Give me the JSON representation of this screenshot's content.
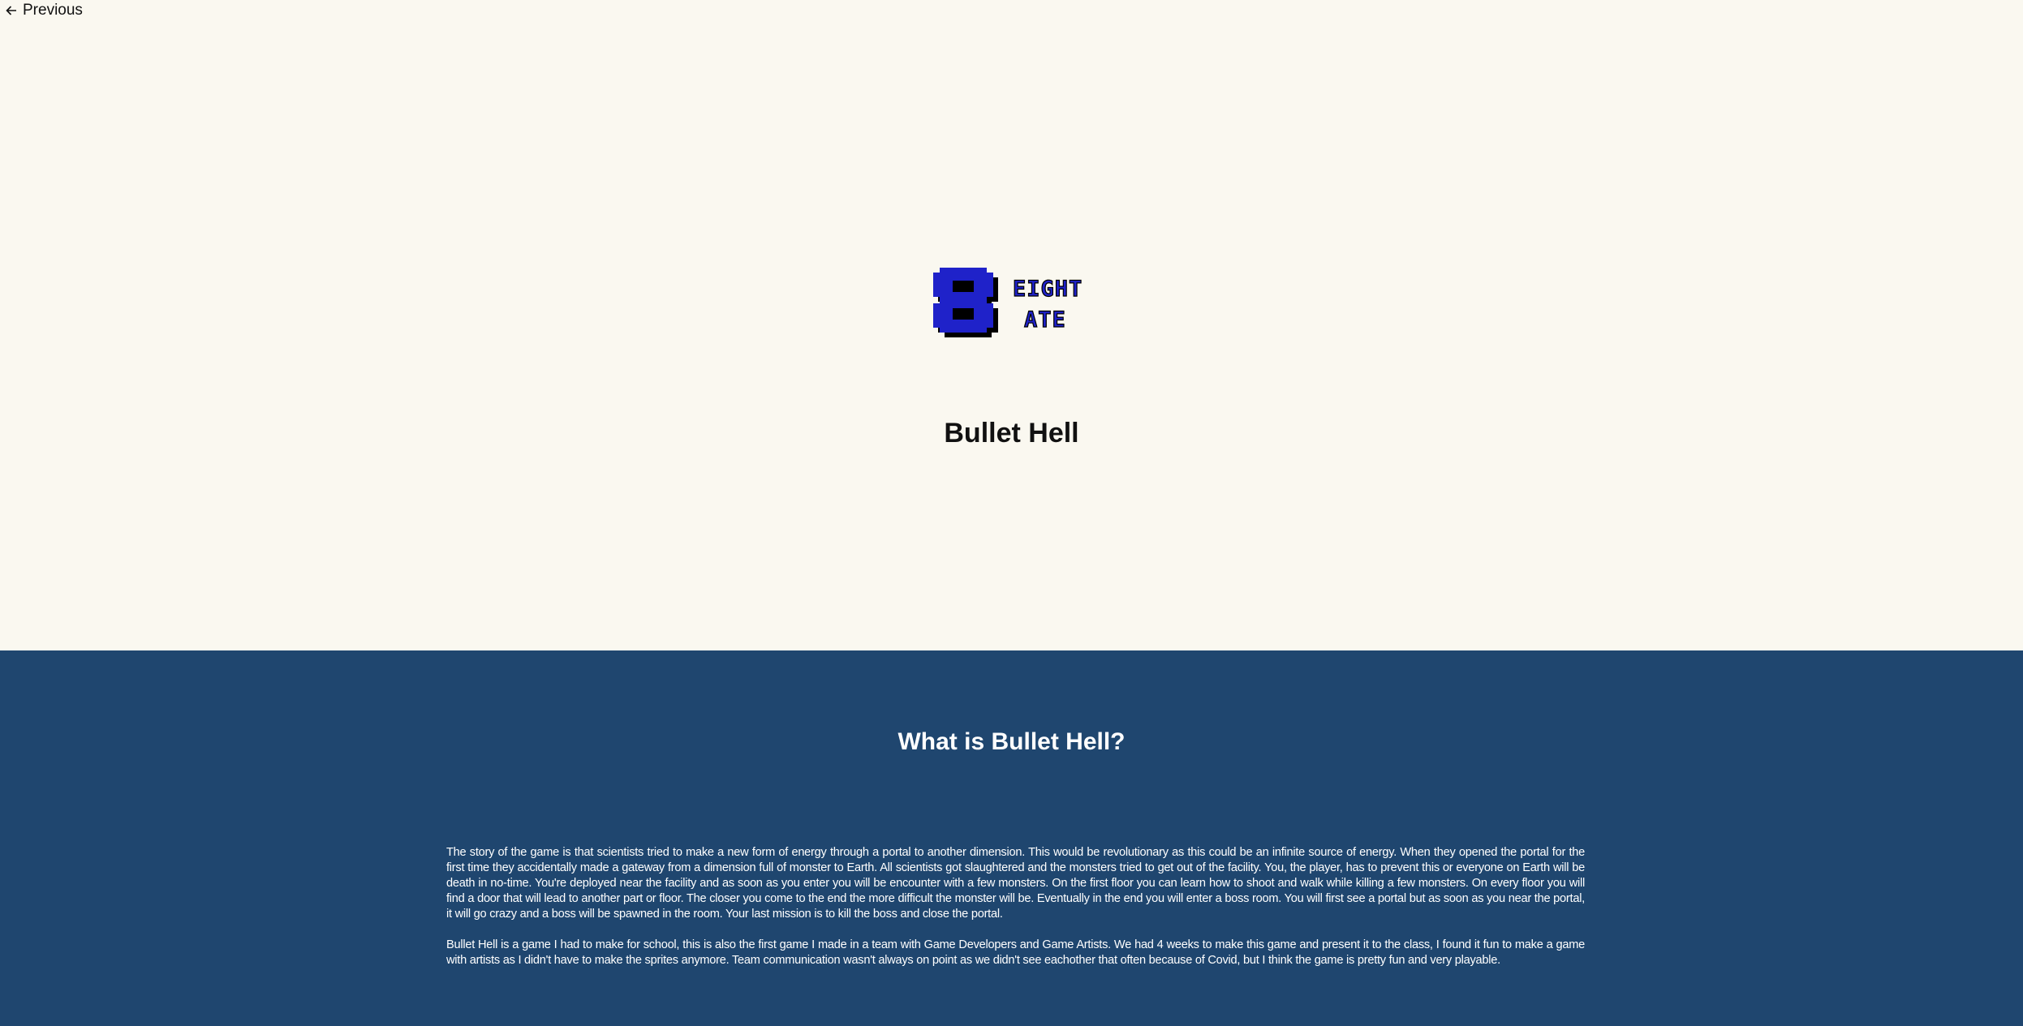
{
  "nav": {
    "previous_label": "Previous",
    "previous_icon": "arrow-left-icon"
  },
  "logo": {
    "big_letter": "8",
    "line1": "EIGHT",
    "line2": "ATE",
    "text_color": "#1f22c9",
    "shadow_color": "#000000"
  },
  "project": {
    "title": "Bullet Hell"
  },
  "about": {
    "heading": "What is Bullet Hell?",
    "paragraphs": [
      "The story of the game is that scientists tried to make a new form of energy through a portal to another dimension. This would be revolutionary as this could be an infinite source of energy. When they opened the portal for the first time they accidentally made a gateway from a dimension full of monster to Earth. All scientists got slaughtered and the monsters tried to get out of the facility. You, the player, has to prevent this or everyone on Earth will be death in no-time. You're deployed near the facility and as soon as you enter you will be encounter with a few monsters. On the first floor you can learn how to shoot and walk while killing a few monsters. On every floor you will find a door that will lead to another part or floor. The closer you come to the end the more difficult the monster will be. Eventually in the end you will enter a boss room. You will first see a portal but as soon as you near the portal, it will go crazy and a boss will be spawned in the room. Your last mission is to kill the boss and close the portal.",
      "Bullet Hell is a game I had to make for school, this is also the first game I made in a team with Game Developers and Game Artists. We had 4 weeks to make this game and present it to the class, I found it fun to make a game with artists as I didn't have to make the sprites anymore. Team communication wasn't always on point as we didn't see eachother that often because of Covid, but I think the game is pretty fun and very playable."
    ]
  },
  "colors": {
    "hero_background": "#faf8f0",
    "about_background": "#1f466f",
    "about_text": "#ffffff"
  }
}
